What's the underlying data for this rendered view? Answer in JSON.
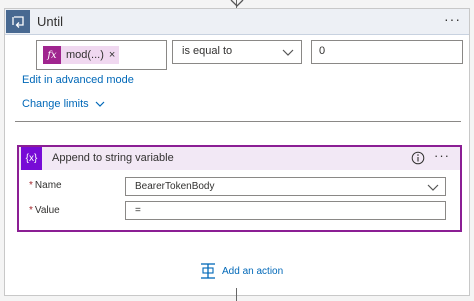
{
  "until": {
    "title": "Until",
    "more": "···",
    "condition": {
      "token_icon": "fx",
      "token_label": "mod(...)",
      "token_close": "×",
      "operator": "is equal to",
      "value": "0"
    },
    "advanced_link": "Edit in advanced mode",
    "limits_link": "Change limits"
  },
  "append": {
    "icon": "{x}",
    "title": "Append to string variable",
    "more": "···",
    "name_label": "Name",
    "name_value": "BearerTokenBody",
    "value_label": "Value",
    "value_value": "="
  },
  "add_action": {
    "label": "Add an action"
  },
  "colors": {
    "until_accent": "#486991",
    "token_accent": "#a0258f",
    "append_border": "#8b1e94",
    "link": "#0068b8"
  }
}
